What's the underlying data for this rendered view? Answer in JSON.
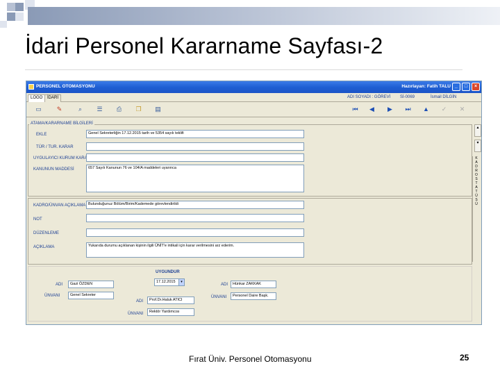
{
  "slide": {
    "title": "İdari Personel Kararname Sayfası-2",
    "footer": "Fırat Üniv. Personel Otomasyonu",
    "page_number": "25"
  },
  "window": {
    "app_title": "PERSONEL OTOMASYONU",
    "user": "Hazırlayan: Fatih TALU",
    "minimize_icon": "minimize-icon",
    "maximize_icon": "maximize-icon",
    "close_icon": "close-icon"
  },
  "tabs": [
    "LOGO",
    "İDARİ"
  ],
  "info_bar": {
    "title_label": "ADI SOYADI : GÖREVİ",
    "sicil": "Sİ-0069",
    "name": "İsmail DİLGİN"
  },
  "toolbar": {
    "tools": [
      "new-icon",
      "edit-icon",
      "search-icon",
      "list-icon",
      "print-icon",
      "copy-icon",
      "paste-icon"
    ],
    "nav": [
      "first-icon",
      "prev-icon",
      "next-icon",
      "last-icon",
      "save-icon",
      "confirm-icon",
      "cancel-icon"
    ]
  },
  "form": {
    "section_label": "ATAMA/KARARNAME BİLGİLERİ",
    "fields": [
      {
        "label": "EKLE",
        "value": "Genel Sekreterliğin 17.12.2015 tarih ve 5354 sayılı teklifi"
      },
      {
        "label": "TÜR / TUR. KARAR",
        "value": ""
      },
      {
        "label": "UYGULAYICI KURUM KARAR",
        "value": ""
      },
      {
        "label": "KANUNUN MADDESİ",
        "value": "657 Sayılı Kanunun 76 ve 104/A maddeleri uyarınca"
      }
    ],
    "fields2": [
      {
        "label": "KADRO/ÜNVAN AÇIKLAMA",
        "value": "Bulunduğunuz Bölüm/Birim/Kademede görevlendirildi"
      },
      {
        "label": "NOT",
        "value": ""
      },
      {
        "label": "DÜZENLEME",
        "value": ""
      },
      {
        "label": "AÇIKLAMA",
        "value": "Yukarıda durumu açıklanan kişinin ilgili ÜNİT'e intikali için karar verilmesini arz ederim."
      }
    ],
    "vertical_tabs": [
      "K",
      "A",
      "D",
      "R",
      "O",
      "S",
      "T",
      "A",
      "T",
      "Ü",
      "S",
      "Ü"
    ]
  },
  "signatures": {
    "uygundur_label": "UYGUNDUR",
    "date": "17.12.2015",
    "left": {
      "name_label": "ADI",
      "name": "Gazi ÖZDEN",
      "title_label": "ÜNVANI",
      "title": "Genel Sekreter"
    },
    "middle": {
      "name_label": "ADI",
      "name": "Prof.Dr.Haluk ATICI",
      "title_label": "ÜNVANI",
      "title": "Rektör Yardımcısı"
    },
    "right": {
      "name_label": "ADI",
      "name": "Hünkar ZAKKAK",
      "title_label": "ÜNVANI",
      "title": "Personel Daire Başk."
    }
  },
  "colors": {
    "titlebar": "#1f5fd3",
    "label": "#1c3f94",
    "window_bg": "#ece9d8"
  }
}
